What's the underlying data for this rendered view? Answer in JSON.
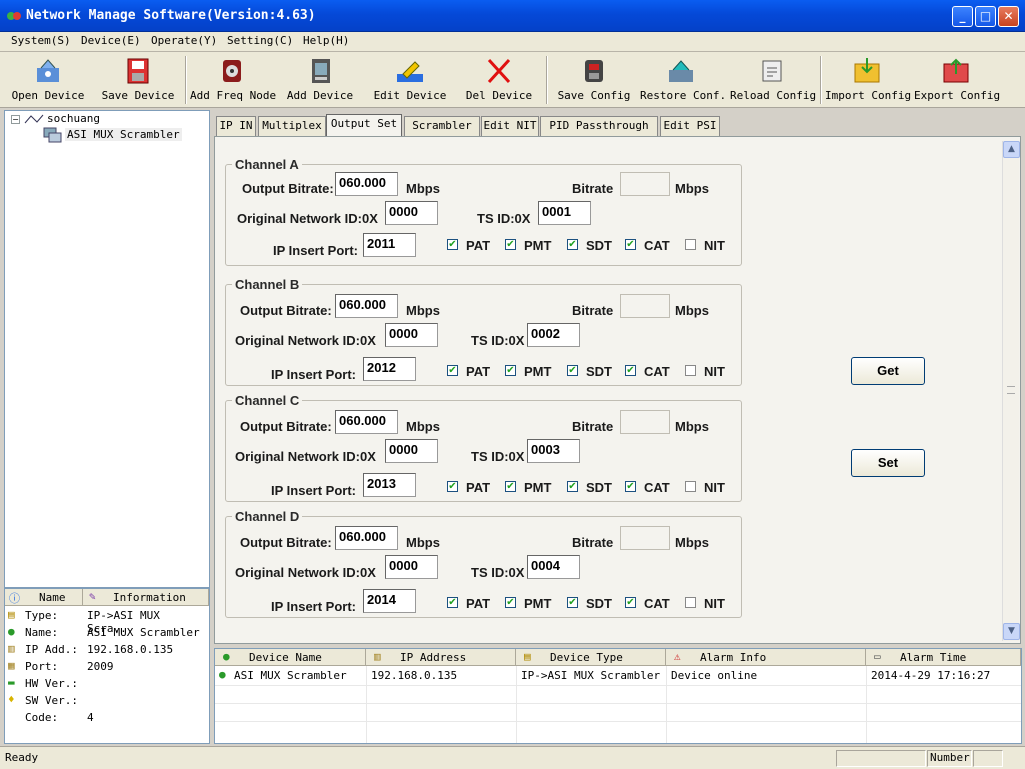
{
  "window": {
    "title": "Network Manage Software(Version:4.63)"
  },
  "menu": [
    {
      "label": "System(S)"
    },
    {
      "label": "Device(E)"
    },
    {
      "label": "Operate(Y)"
    },
    {
      "label": "Setting(C)"
    },
    {
      "label": "Help(H)"
    }
  ],
  "toolbar": [
    {
      "label": "Open Device",
      "icon": "open-device-icon"
    },
    {
      "label": "Save Device",
      "icon": "save-device-icon"
    },
    {
      "label": "Add Freq Node",
      "icon": "add-freq-node-icon"
    },
    {
      "label": "Add Device",
      "icon": "add-device-icon"
    },
    {
      "label": "Edit Device",
      "icon": "edit-device-icon"
    },
    {
      "label": "Del Device",
      "icon": "del-device-icon"
    },
    {
      "label": "Save Config",
      "icon": "save-config-icon"
    },
    {
      "label": "Restore Conf.",
      "icon": "restore-conf-icon"
    },
    {
      "label": "Reload Config",
      "icon": "reload-config-icon"
    },
    {
      "label": "Import Config",
      "icon": "import-config-icon"
    },
    {
      "label": "Export Config",
      "icon": "export-config-icon"
    }
  ],
  "tree": {
    "root": "sochuang",
    "child": "ASI MUX Scrambler"
  },
  "info": {
    "headers": [
      "Name",
      "Information"
    ],
    "rows": [
      {
        "name": "Type:",
        "value": "IP->ASI MUX Scra..."
      },
      {
        "name": "Name:",
        "value": "ASI MUX Scrambler"
      },
      {
        "name": "IP Add.:",
        "value": "192.168.0.135"
      },
      {
        "name": "Port:",
        "value": "2009"
      },
      {
        "name": "HW Ver.:",
        "value": ""
      },
      {
        "name": "SW Ver.:",
        "value": ""
      },
      {
        "name": "Code:",
        "value": "4"
      }
    ]
  },
  "tabs": [
    "IP IN",
    "Multiplex",
    "Output Set",
    "Scrambler",
    "Edit NIT",
    "PID Passthrough",
    "Edit PSI"
  ],
  "labels": {
    "output_bitrate": "Output Bitrate:",
    "mbps": "Mbps",
    "bitrate": "Bitrate",
    "onid": "Original Network ID:0X",
    "tsid": "TS ID:0X",
    "ip_port": "IP Insert Port:",
    "pat": "PAT",
    "pmt": "PMT",
    "sdt": "SDT",
    "cat": "CAT",
    "nit": "NIT"
  },
  "channels": [
    {
      "title": "Channel A",
      "output_bitrate": "060.000",
      "bitrate": "",
      "onid": "0000",
      "tsid": "0001",
      "port": "2011",
      "pat": true,
      "pmt": true,
      "sdt": true,
      "cat": true,
      "nit": false
    },
    {
      "title": "Channel B",
      "output_bitrate": "060.000",
      "bitrate": "",
      "onid": "0000",
      "tsid": "0002",
      "port": "2012",
      "pat": true,
      "pmt": true,
      "sdt": true,
      "cat": true,
      "nit": false
    },
    {
      "title": "Channel C",
      "output_bitrate": "060.000",
      "bitrate": "",
      "onid": "0000",
      "tsid": "0003",
      "port": "2013",
      "pat": true,
      "pmt": true,
      "sdt": true,
      "cat": true,
      "nit": false
    },
    {
      "title": "Channel D",
      "output_bitrate": "060.000",
      "bitrate": "",
      "onid": "0000",
      "tsid": "0004",
      "port": "2014",
      "pat": true,
      "pmt": true,
      "sdt": true,
      "cat": true,
      "nit": false
    }
  ],
  "buttons": {
    "get": "Get",
    "set": "Set"
  },
  "list": {
    "headers": [
      "Device Name",
      "IP Address",
      "Device Type",
      "Alarm Info",
      "Alarm Time"
    ],
    "rows": [
      {
        "device_name": "ASI MUX Scrambler",
        "ip": "192.168.0.135",
        "type": "IP->ASI MUX Scrambler",
        "alarm": "Device online",
        "time": "2014-4-29 17:16:27"
      }
    ]
  },
  "status": {
    "text": "Ready",
    "number_label": "Number"
  },
  "colors": {
    "title_blue": "#0549d8",
    "check_green": "#21a121"
  }
}
